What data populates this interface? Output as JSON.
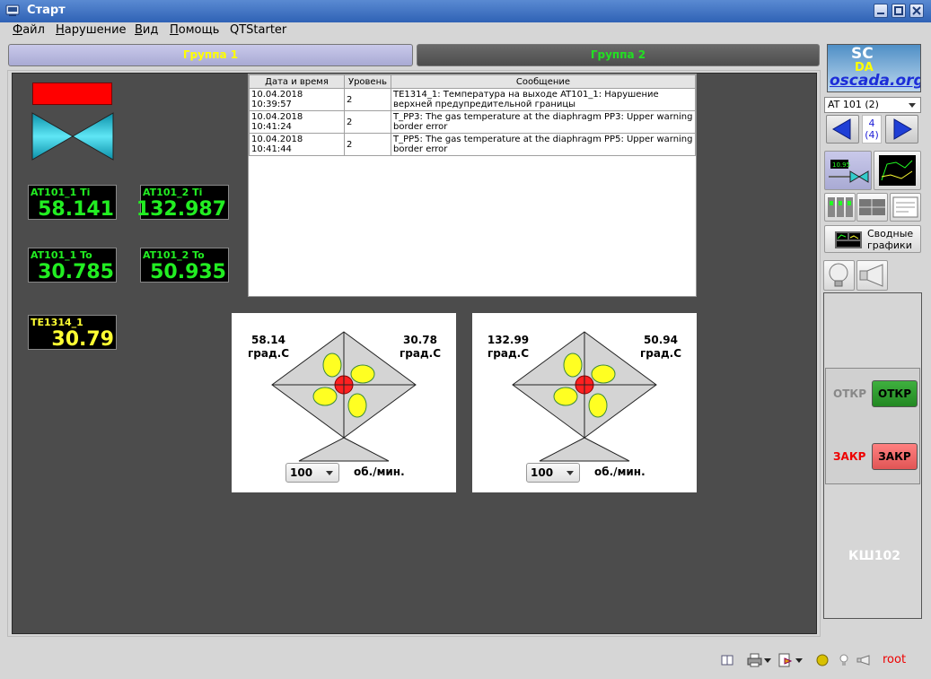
{
  "window": {
    "title": "Старт"
  },
  "menu": [
    {
      "ul": "Ф",
      "rest": "айл"
    },
    {
      "ul": "Н",
      "rest": "арушение"
    },
    {
      "ul": "В",
      "rest": "ид"
    },
    {
      "ul": "П",
      "rest": "омощь"
    },
    {
      "ul": "",
      "rest": "QTStarter"
    }
  ],
  "tabs": {
    "group1": "Группа 1",
    "group2": "Группа 2"
  },
  "displays": {
    "at101_1_ti": {
      "label": "AT101_1 Ti",
      "value": "58.141"
    },
    "at101_2_ti": {
      "label": "AT101_2 Ti",
      "value": "132.987"
    },
    "at101_1_to": {
      "label": "AT101_1 To",
      "value": "30.785"
    },
    "at101_2_to": {
      "label": "AT101_2 To",
      "value": "50.935"
    },
    "te1314_1": {
      "label": "TE1314_1",
      "value": "30.79"
    }
  },
  "messages": {
    "columns": [
      "Дата и время",
      "Уровень",
      "Сообщение"
    ],
    "rows": [
      [
        "10.04.2018 10:39:57",
        "2",
        "TE1314_1: Температура на выходе AT101_1: Нарушение верхней предупредительной границы"
      ],
      [
        "10.04.2018 10:41:24",
        "2",
        "T_PP3: The gas temperature at the diaphragm PP3: Upper warning border error"
      ],
      [
        "10.04.2018 10:41:44",
        "2",
        "T_PP5: The gas temperature at the diaphragm PP5: Upper warning border error"
      ]
    ]
  },
  "fans": [
    {
      "t_in": "58.14",
      "t_out": "30.78",
      "unit": "град.С",
      "speed": "100",
      "rpm_label": "об./мин."
    },
    {
      "t_in": "132.99",
      "t_out": "50.94",
      "unit": "град.С",
      "speed": "100",
      "rpm_label": "об./мин."
    }
  ],
  "sidebar": {
    "logo_sc": "SC",
    "logo_da": "DA",
    "logo_url": "oscada.org",
    "mini_value": "10.95",
    "object_select": "AT 101 (2)",
    "page": "4",
    "page_total": "(4)",
    "summary_button": "Сводные графики",
    "state_open_label": "ОТКР",
    "open_button": "ОТКР",
    "state_close_label": "ЗАКР",
    "close_button": "ЗАКР",
    "device_name": "КШ102"
  },
  "status": {
    "user": "root"
  },
  "colors": {
    "alarm": "#ff0000",
    "value_green": "#22ee22",
    "value_yellow": "#ffff33",
    "open_btn": "#2ea02e",
    "close_btn": "#f06060"
  }
}
